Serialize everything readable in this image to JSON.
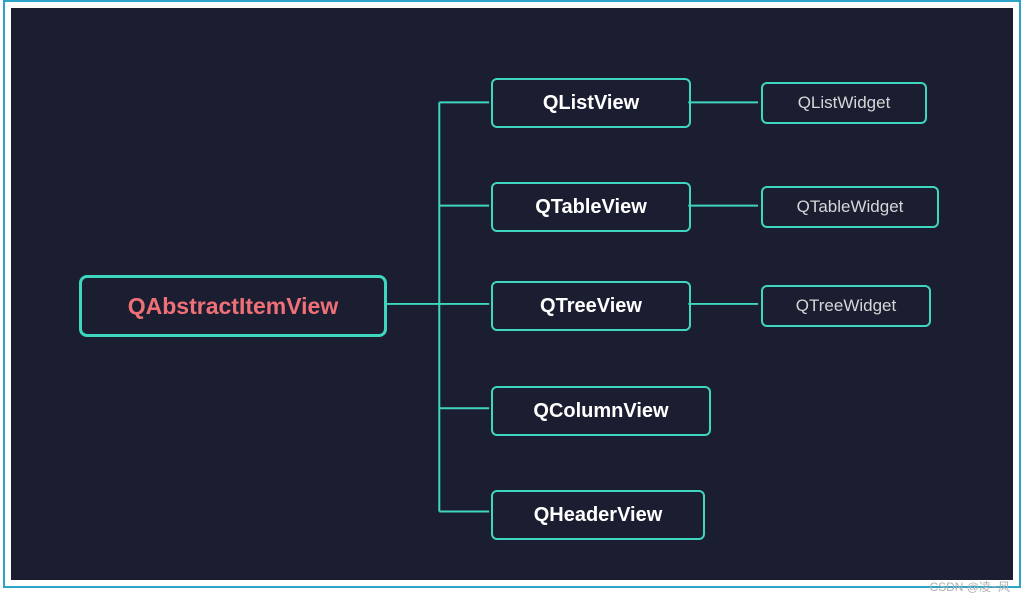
{
  "root": {
    "label": "QAbstractItemView"
  },
  "level1": {
    "list": {
      "label": "QListView"
    },
    "table": {
      "label": "QTableView"
    },
    "tree": {
      "label": "QTreeView"
    },
    "column": {
      "label": "QColumnView"
    },
    "header": {
      "label": "QHeaderView"
    }
  },
  "level2": {
    "list": {
      "label": "QListWidget"
    },
    "table": {
      "label": "QTableWidget"
    },
    "tree": {
      "label": "QTreeWidget"
    }
  },
  "colors": {
    "background": "#1b1e31",
    "node_border": "#3fd6c0",
    "root_text": "#f07077",
    "connector": "#3fd6c0"
  },
  "watermark": {
    "corner": "CSDN @凌~风"
  }
}
